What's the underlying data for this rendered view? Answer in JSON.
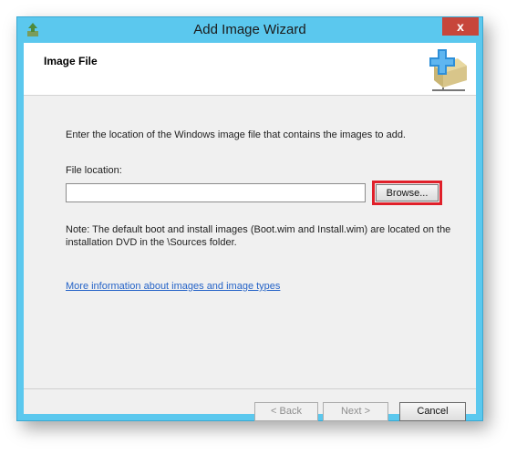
{
  "window": {
    "title": "Add Image Wizard",
    "close_label": "x"
  },
  "header": {
    "title": "Image File"
  },
  "main": {
    "instruction": "Enter the location of the Windows image file that contains the images to add.",
    "file_location_label": "File location:",
    "file_location_value": "",
    "browse_label": "Browse...",
    "note_line1": "Note: The default boot and install images (Boot.wim and Install.wim) are located on the",
    "note_line2": "installation DVD in the \\Sources folder.",
    "help_link": "More information about images and image types"
  },
  "footer": {
    "back_label": "< Back",
    "next_label": "Next >",
    "cancel_label": "Cancel"
  },
  "colors": {
    "titlebar": "#5bc8ee",
    "close": "#c7463b",
    "highlight": "#e0202a",
    "link": "#2563c7"
  },
  "icons": [
    "wizard-app-icon",
    "close-icon",
    "add-image-box-icon"
  ]
}
